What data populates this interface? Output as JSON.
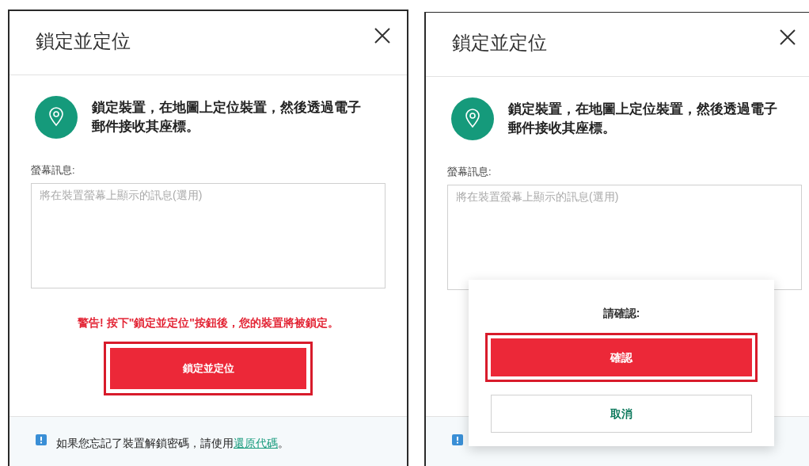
{
  "panels": [
    {
      "title": "鎖定並定位",
      "description": "鎖定裝置，在地圖上定位裝置，然後透過電子郵件接收其座標。",
      "message_label": "螢幕訊息:",
      "message_field": {
        "placeholder": "將在裝置螢幕上顯示的訊息(選用)"
      },
      "warning": "警告! 按下\"鎖定並定位\"按鈕後，您的裝置將被鎖定。",
      "lock_button": {
        "label": "鎖定並定位",
        "highlighted": true
      },
      "footer": {
        "text": "如果您忘記了裝置解鎖密碼，請使用",
        "link": "還原代碼",
        "end": "。"
      }
    },
    {
      "title": "鎖定並定位",
      "description": "鎖定裝置，在地圖上定位裝置，然後透過電子郵件接收其座標。",
      "message_label": "螢幕訊息:",
      "message_field": {
        "placeholder": "將在裝置螢幕上顯示的訊息(選用)"
      },
      "confirm_popup": {
        "title": "請確認:",
        "buttons": [
          {
            "label": "確認",
            "kind": "primary",
            "highlighted": true
          },
          {
            "label": "取消",
            "kind": "secondary",
            "highlighted": false
          }
        ]
      }
    }
  ]
}
